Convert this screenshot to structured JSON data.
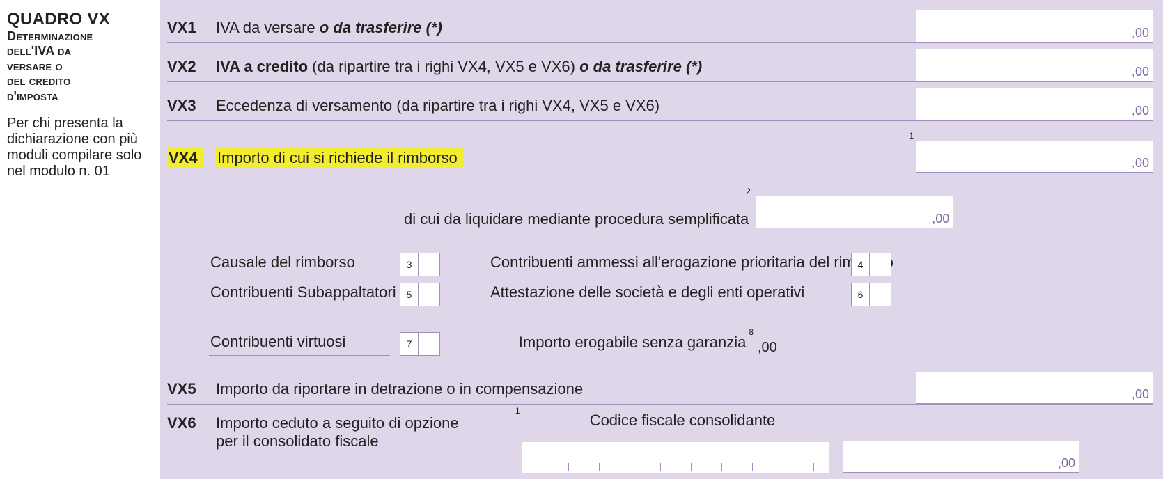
{
  "sidebar": {
    "title": "QUADRO VX",
    "subtitle_html_lines": [
      "Determinazione",
      "dell'IVA da",
      "versare o",
      "del credito",
      "d'imposta"
    ],
    "note": "Per chi presenta la dichiarazione con più moduli compilare solo nel modulo n. 01"
  },
  "rows": {
    "vx1": {
      "code": "VX1",
      "desc_pre": "IVA da versare ",
      "desc_em": "o da trasferire (*)",
      "suffix": ",00"
    },
    "vx2": {
      "code": "VX2",
      "desc_b": "IVA a credito",
      "desc_plain": " (da ripartire tra i righi VX4, VX5 e VX6) ",
      "desc_em": "o da trasferire (*)",
      "suffix": ",00"
    },
    "vx3": {
      "code": "VX3",
      "desc": "Eccedenza di versamento (da ripartire tra i righi VX4, VX5 e VX6)",
      "suffix": ",00"
    },
    "vx4": {
      "code": "VX4",
      "desc": "Importo di cui si richiede il rimborso",
      "sup1": "1",
      "suffix": ",00",
      "sub2_label": "di cui da liquidare mediante procedura semplificata",
      "sub2_sup": "2",
      "sub2_suffix": ",00",
      "f3_label": "Causale del rimborso",
      "f3_num": "3",
      "f4_label": "Contribuenti ammessi all'erogazione prioritaria del rimborso",
      "f4_num": "4",
      "f5_label": "Contribuenti Subappaltatori",
      "f5_num": "5",
      "f6_label": "Attestazione delle società e degli enti operativi",
      "f6_num": "6",
      "f7_label": "Contribuenti virtuosi",
      "f7_num": "7",
      "f8_label": "Importo erogabile senza garanzia",
      "f8_sup": "8",
      "f8_suffix": ",00"
    },
    "vx5": {
      "code": "VX5",
      "desc": "Importo da riportare in detrazione o in compensazione",
      "suffix": ",00"
    },
    "vx6": {
      "code": "VX6",
      "desc_line1": "Importo ceduto a seguito di opzione",
      "desc_line2": "per il consolidato fiscale",
      "sup1": "1",
      "cf_label": "Codice fiscale consolidante",
      "suffix": ",00"
    }
  }
}
